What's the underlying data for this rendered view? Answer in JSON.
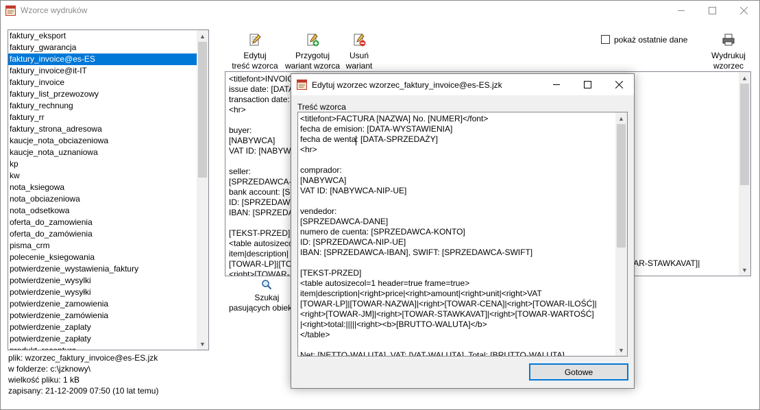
{
  "window": {
    "title": "Wzorce wydruków"
  },
  "icons": {
    "app": "app-template-icon",
    "minimize": "minimize-icon",
    "maximize": "maximize-icon",
    "close": "close-icon",
    "edit": "edit-pencil-icon",
    "prepare": "add-variant-icon",
    "delete": "delete-variant-icon",
    "print": "printer-icon",
    "search": "magnifier-icon"
  },
  "colors": {
    "selection": "#0078d7",
    "dialog_bg": "#f0f0f0",
    "default_button_border": "#0078d7"
  },
  "templates": {
    "selected_index": 2,
    "items": [
      "faktury_eksport",
      "faktury_gwarancja",
      "faktury_invoice@es-ES",
      "faktury_invoice@it-IT",
      "faktury_invoice",
      "faktury_list_przewozowy",
      "faktury_rechnung",
      "faktury_rr",
      "faktury_strona_adresowa",
      "kaucje_nota_obciazeniowa",
      "kaucje_nota_uznaniowa",
      "kp",
      "kw",
      "nota_ksiegowa",
      "nota_obciazeniowa",
      "nota_odsetkowa",
      "oferta_do_zamowienia",
      "oferta_do_zamówienia",
      "pisma_crm",
      "polecenie_ksiegowania",
      "potwierdzenie_wystawienia_faktury",
      "potwierdzenie_wysylki",
      "potwierdzenie_wysyłki",
      "potwierdzenie_zamowienia",
      "potwierdzenie_zamówienia",
      "potwierdzenie_zaplaty",
      "potwierdzenie_zapłaty",
      "produkt_receptura"
    ]
  },
  "file_info": {
    "file": "plik: wzorzec_faktury_invoice@es-ES.jzk",
    "folder": "w folderze: c:\\jzknowy\\",
    "size": "wielkość pliku: 1 kB",
    "saved": "zapisany: 21-12-2009 07:50 (10 lat temu)"
  },
  "toolbar": {
    "edit": "Edytuj\ntreść wzorca",
    "prepare": "Przygotuj\nwariant wzorca",
    "delete": "Usuń\nwariant",
    "print": "Wydrukuj\nwzorzec",
    "show_last_data": "pokaż ostatnie dane",
    "search": "Szukaj\npasujących obiektów"
  },
  "background_editor": {
    "text": "<titlefont>INVOICE\nissue date: [DATA-\ntransaction date:\n<hr>\n\nbuyer:\n[NABYWCA]\nVAT ID: [NABYWCA\n\nseller:\n[SPRZEDAWCA-D\nbank account: [S\nID: [SPRZEDAWCA\nIBAN: [SPRZEDAW\n\n[TEKST-PRZED]\n<table autosizeco\nitem|description|\n[TOWAR-LP]|[TOW\n<right>[TOWAR-",
    "tail": "OWAR-STAWKAVAT]|"
  },
  "dialog": {
    "title": "Edytuj wzorzec wzorzec_faktury_invoice@es-ES.jzk",
    "label": "Treść wzorca",
    "content": "<titlefont>FACTURA [NAZWA] No. [NUMER]</font>\nfecha de emision: [DATA-WYSTAWIENIA]\nfecha de wenta: [DATA-SPRZEDAŻY]\n<hr>\n\ncomprador:\n[NABYWCA]\nVAT ID: [NABYWCA-NIP-UE]\n\nvendedor:\n[SPRZEDAWCA-DANE]\nnumero de cuenta: [SPRZEDAWCA-KONTO]\nID: [SPRZEDAWCA-NIP-UE]\nIBAN: [SPRZEDAWCA-IBAN], SWIFT: [SPRZEDAWCA-SWIFT]\n\n[TEKST-PRZED]\n<table autosizecol=1 header=true frame=true>\nitem|description|<right>price|<right>amount|<right>unit|<right>VAT\n[TOWAR-LP]|[TOWAR-NAZWA]|<right>[TOWAR-CENA]|<right>[TOWAR-ILOŚĆ]|\n<right>[TOWAR-JM]|<right>[TOWAR-STAWKAVAT]|<right>[TOWAR-WARTOŚĆ]\n|<right>total:|||||<right><b>[BRUTTO-WALUTA]</b>\n</table>\n\nNet: [NETTO-WALUTA], VAT: [VAT-WALUTA], Total: [BRUTTO-WALUTA]",
    "ok_button": "Gotowe"
  }
}
